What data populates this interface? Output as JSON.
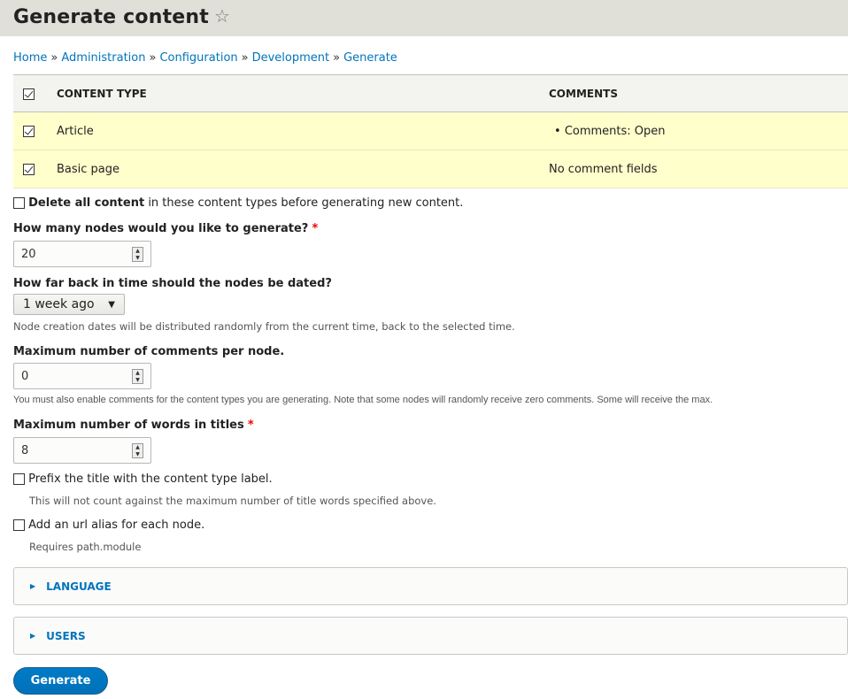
{
  "page": {
    "title": "Generate content"
  },
  "breadcrumb": [
    "Home",
    "Administration",
    "Configuration",
    "Development",
    "Generate"
  ],
  "table": {
    "headers": [
      "CONTENT TYPE",
      "COMMENTS"
    ],
    "rows": [
      {
        "type": "Article",
        "comments": "Comments: Open",
        "checked": true
      },
      {
        "type": "Basic page",
        "comments": "No comment fields",
        "checked": true
      }
    ]
  },
  "delete": {
    "bold": "Delete all content",
    "rest": " in these content types before generating new content.",
    "checked": false
  },
  "nodes": {
    "label": "How many nodes would you like to generate?",
    "required": "*",
    "value": "20"
  },
  "dated": {
    "label": "How far back in time should the nodes be dated?",
    "value": "1 week ago",
    "desc": "Node creation dates will be distributed randomly from the current time, back to the selected time."
  },
  "comments": {
    "label": "Maximum number of comments per node.",
    "value": "0",
    "desc": "You must also enable comments for the content types you are generating. Note that some nodes will randomly receive zero comments. Some will receive the max."
  },
  "words": {
    "label": "Maximum number of words in titles",
    "required": "*",
    "value": "8"
  },
  "prefix": {
    "label": "Prefix the title with the content type label.",
    "desc": "This will not count against the maximum number of title words specified above.",
    "checked": false
  },
  "alias": {
    "label": "Add an url alias for each node.",
    "desc": "Requires path.module",
    "checked": false
  },
  "details": [
    "LANGUAGE",
    "USERS"
  ],
  "submit": "Generate"
}
